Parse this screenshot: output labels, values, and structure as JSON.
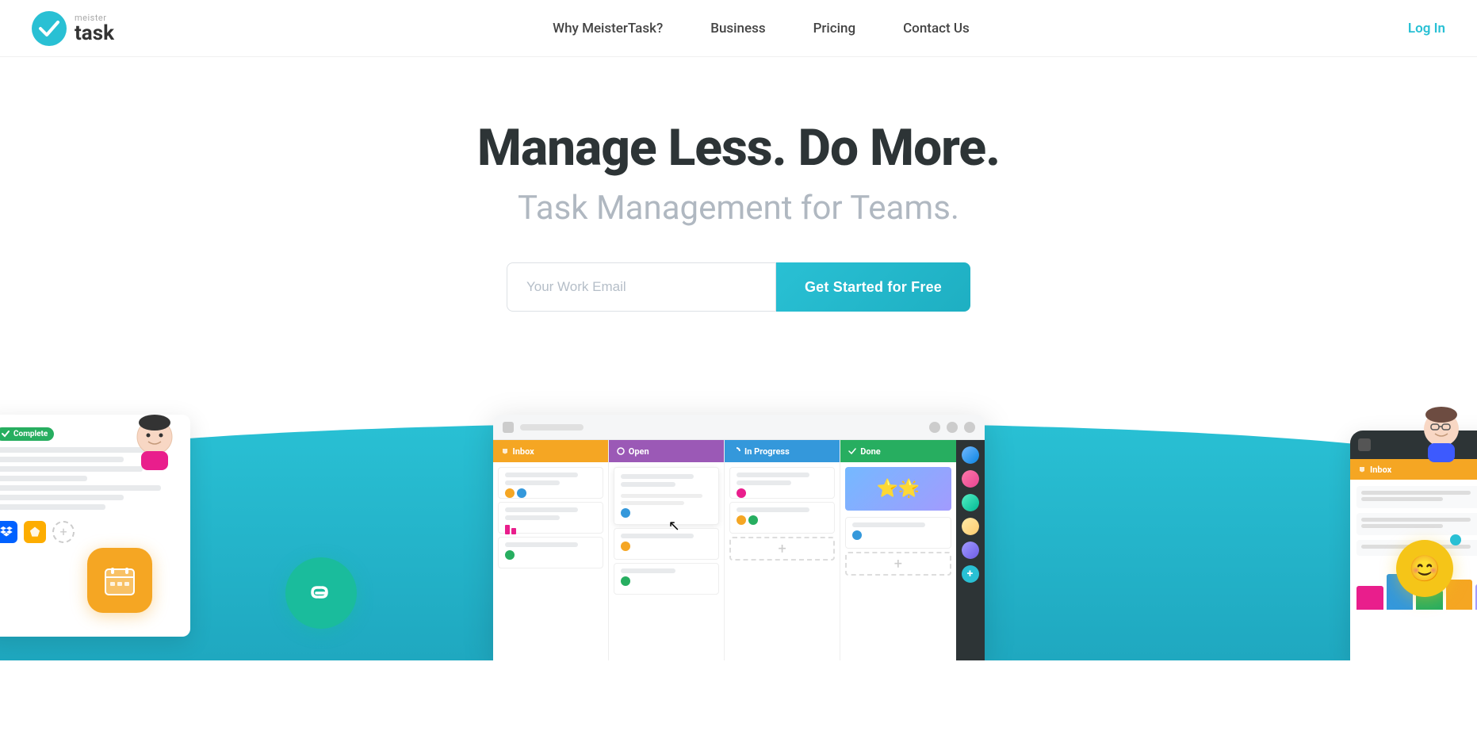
{
  "brand": {
    "meister": "meister",
    "task": "task",
    "logo_alt": "MeisterTask Logo"
  },
  "nav": {
    "why_label": "Why MeisterTask?",
    "business_label": "Business",
    "pricing_label": "Pricing",
    "contact_label": "Contact Us",
    "login_label": "Log In"
  },
  "hero": {
    "title": "Manage Less. Do More.",
    "subtitle": "Task Management for Teams.",
    "email_placeholder": "Your Work Email",
    "cta_label": "Get Started for Free"
  },
  "kanban": {
    "col_inbox": "Inbox",
    "col_open": "Open",
    "col_inprogress": "In Progress",
    "col_done": "Done"
  },
  "mobile": {
    "inbox_label": "Inbox"
  },
  "left_card": {
    "badge": "Complete"
  },
  "colors": {
    "accent": "#29c0d4",
    "orange": "#f5a623",
    "teal": "#1abc9c",
    "yellow": "#f5c518",
    "dark": "#2d3436"
  }
}
